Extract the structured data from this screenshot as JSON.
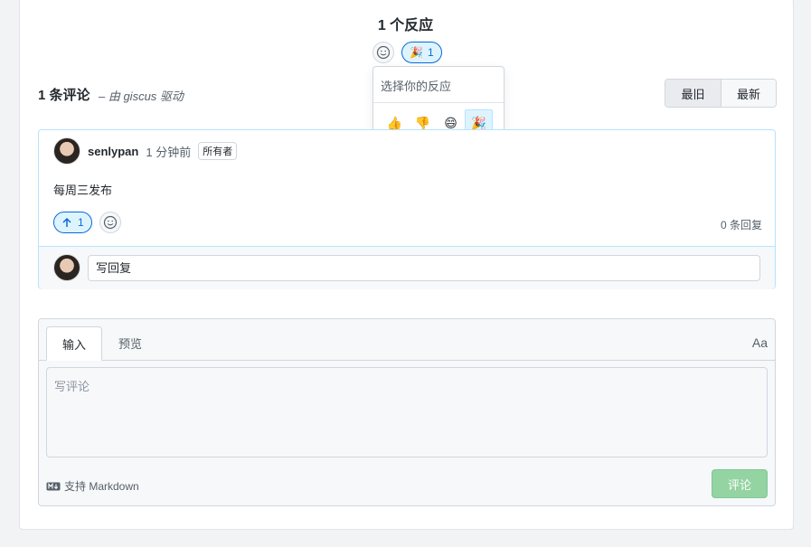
{
  "reactions": {
    "title": "1 个反应",
    "selected_reaction_emoji": "🎉",
    "selected_reaction_count": "1"
  },
  "reaction_picker": {
    "title": "选择你的反应",
    "emojis": [
      "👍",
      "👎",
      "😄",
      "🎉",
      "😕",
      "❤️",
      "🚀",
      "👀"
    ],
    "active_emoji": "🎉"
  },
  "discussion": {
    "comment_count": "1 条评论",
    "powered_by": "– 由 giscus 驱动",
    "sort_oldest": "最旧",
    "sort_newest": "最新"
  },
  "comment": {
    "author": "senlypan",
    "time": "1 分钟前",
    "badge": "所有者",
    "body": "每周三发布",
    "upvotes": "1",
    "replies": "0 条回复",
    "reply_placeholder": "写回复"
  },
  "editor": {
    "tab_write": "输入",
    "tab_preview": "预览",
    "text_size": "Aa",
    "placeholder": "写评论",
    "markdown_note": "支持 Markdown",
    "submit_label": "评论"
  },
  "colors": {
    "accent": "#0969da",
    "submit_disabled": "#94d3a2"
  }
}
